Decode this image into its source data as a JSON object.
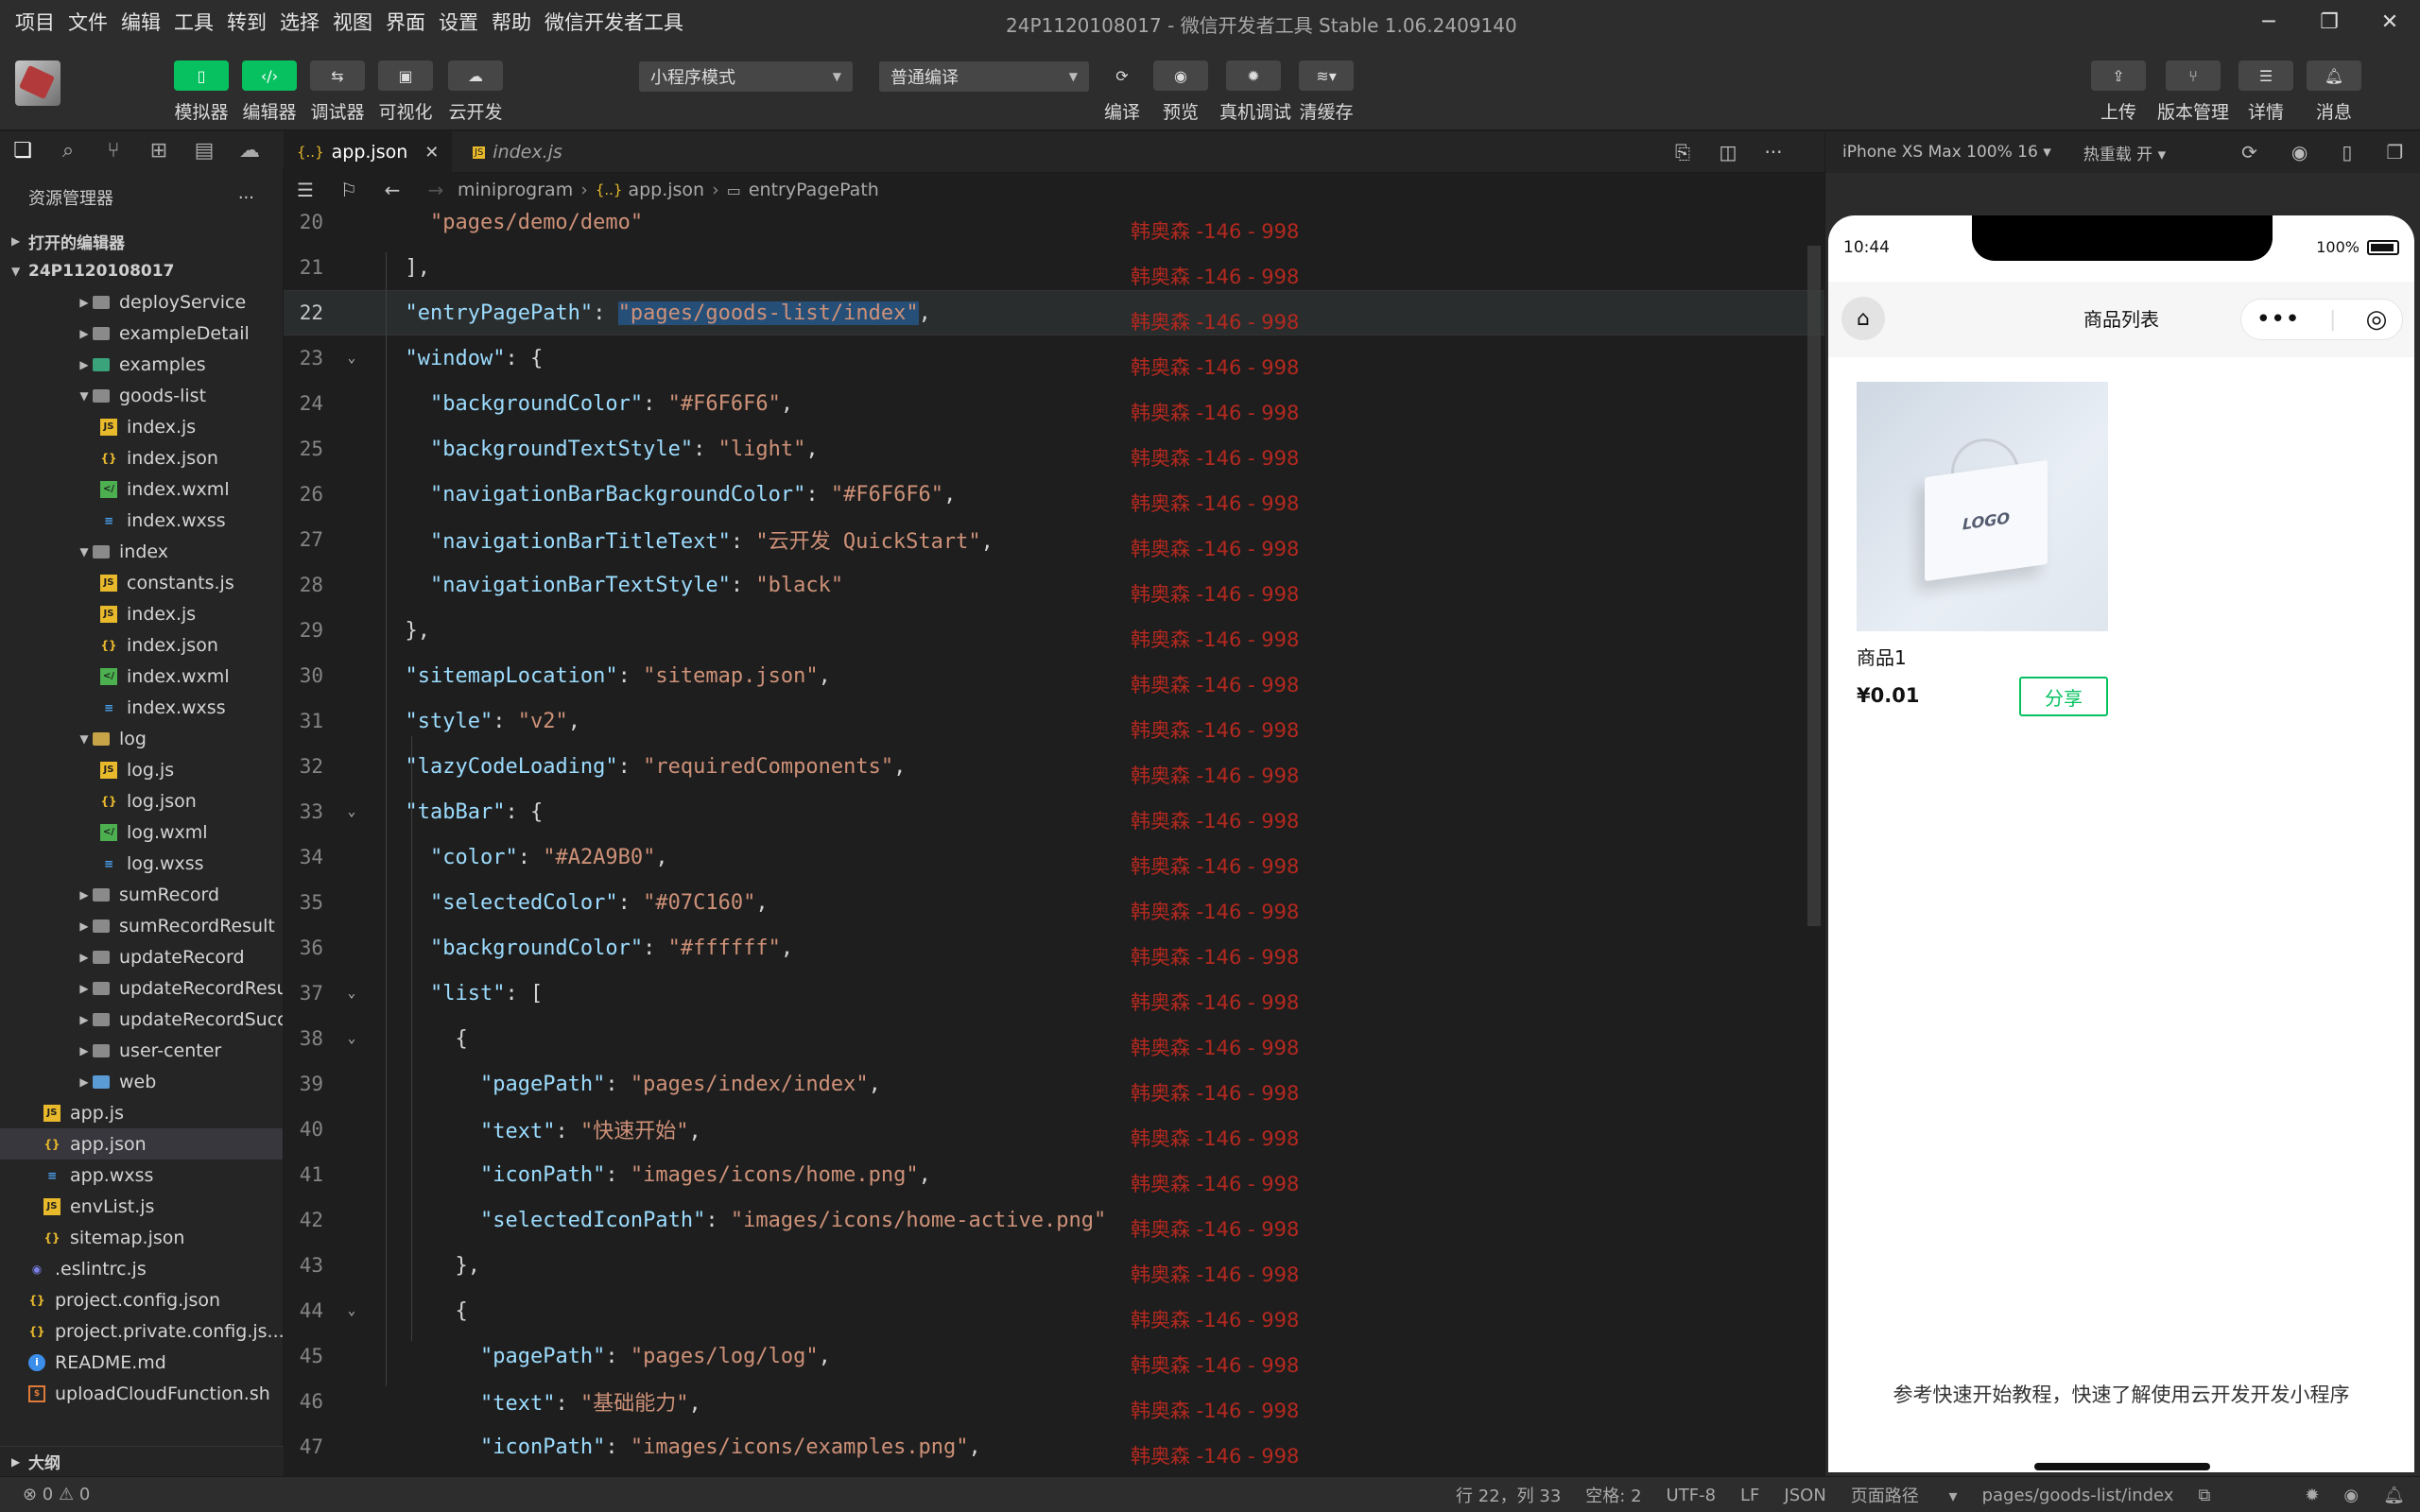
{
  "menu": [
    "项目",
    "文件",
    "编辑",
    "工具",
    "转到",
    "选择",
    "视图",
    "界面",
    "设置",
    "帮助",
    "微信开发者工具"
  ],
  "window_title": "24P1120108017 - 微信开发者工具 Stable 1.06.2409140",
  "toolbar": {
    "simulator": "模拟器",
    "editor": "编辑器",
    "debugger": "调试器",
    "visual": "可视化",
    "cloud": "云开发",
    "mode_select": "小程序模式",
    "compile_select": "普通编译",
    "compile": "编译",
    "preview": "预览",
    "real_debug": "真机调试",
    "clear_cache": "清缓存",
    "upload": "上传",
    "version": "版本管理",
    "details": "详情",
    "messages": "消息"
  },
  "explorer": {
    "title": "资源管理器",
    "open_editors": "打开的编辑器",
    "project": "24P1120108017",
    "outline": "大纲",
    "items": [
      {
        "label": "deployService",
        "type": "folder"
      },
      {
        "label": "exampleDetail",
        "type": "folder"
      },
      {
        "label": "examples",
        "type": "folder"
      },
      {
        "label": "goods-list",
        "type": "folder-open"
      },
      {
        "label": "index.js",
        "type": "js"
      },
      {
        "label": "index.json",
        "type": "json"
      },
      {
        "label": "index.wxml",
        "type": "wxml"
      },
      {
        "label": "index.wxss",
        "type": "wxss"
      },
      {
        "label": "index",
        "type": "folder-open"
      },
      {
        "label": "constants.js",
        "type": "js"
      },
      {
        "label": "index.js",
        "type": "js"
      },
      {
        "label": "index.json",
        "type": "json"
      },
      {
        "label": "index.wxml",
        "type": "wxml"
      },
      {
        "label": "index.wxss",
        "type": "wxss"
      },
      {
        "label": "log",
        "type": "folder-open"
      },
      {
        "label": "log.js",
        "type": "js"
      },
      {
        "label": "log.json",
        "type": "json"
      },
      {
        "label": "log.wxml",
        "type": "wxml"
      },
      {
        "label": "log.wxss",
        "type": "wxss"
      },
      {
        "label": "sumRecord",
        "type": "folder"
      },
      {
        "label": "sumRecordResult",
        "type": "folder"
      },
      {
        "label": "updateRecord",
        "type": "folder"
      },
      {
        "label": "updateRecordResult",
        "type": "folder"
      },
      {
        "label": "updateRecordSuccess",
        "type": "folder"
      },
      {
        "label": "user-center",
        "type": "folder"
      },
      {
        "label": "web",
        "type": "folder"
      },
      {
        "label": "app.js",
        "type": "js"
      },
      {
        "label": "app.json",
        "type": "json"
      },
      {
        "label": "app.wxss",
        "type": "wxss"
      },
      {
        "label": "envList.js",
        "type": "js"
      },
      {
        "label": "sitemap.json",
        "type": "json"
      },
      {
        "label": ".eslintrc.js",
        "type": "eslint"
      },
      {
        "label": "project.config.json",
        "type": "json"
      },
      {
        "label": "project.private.config.js...",
        "type": "json"
      },
      {
        "label": "README.md",
        "type": "info"
      },
      {
        "label": "uploadCloudFunction.sh",
        "type": "sh"
      }
    ]
  },
  "tabs": [
    {
      "label": "app.json",
      "active": true
    },
    {
      "label": "index.js",
      "active": false
    }
  ],
  "breadcrumb": [
    "miniprogram",
    "app.json",
    "entryPagePath"
  ],
  "code": {
    "watermark": "韩奥森 -146 - 998",
    "lines": [
      {
        "n": "20",
        "text": "    \"pages/demo/demo\""
      },
      {
        "n": "21",
        "text": "  ],"
      },
      {
        "n": "22",
        "text": "  \"entryPagePath\": \"pages/goods-list/index\","
      },
      {
        "n": "23",
        "text": "  \"window\": {"
      },
      {
        "n": "24",
        "text": "    \"backgroundColor\": \"#F6F6F6\","
      },
      {
        "n": "25",
        "text": "    \"backgroundTextStyle\": \"light\","
      },
      {
        "n": "26",
        "text": "    \"navigationBarBackgroundColor\": \"#F6F6F6\","
      },
      {
        "n": "27",
        "text": "    \"navigationBarTitleText\": \"云开发 QuickStart\","
      },
      {
        "n": "28",
        "text": "    \"navigationBarTextStyle\": \"black\""
      },
      {
        "n": "29",
        "text": "  },"
      },
      {
        "n": "30",
        "text": "  \"sitemapLocation\": \"sitemap.json\","
      },
      {
        "n": "31",
        "text": "  \"style\": \"v2\","
      },
      {
        "n": "32",
        "text": "  \"lazyCodeLoading\": \"requiredComponents\","
      },
      {
        "n": "33",
        "text": "  \"tabBar\": {"
      },
      {
        "n": "34",
        "text": "    \"color\": \"#A2A9B0\","
      },
      {
        "n": "35",
        "text": "    \"selectedColor\": \"#07C160\","
      },
      {
        "n": "36",
        "text": "    \"backgroundColor\": \"#ffffff\","
      },
      {
        "n": "37",
        "text": "    \"list\": ["
      },
      {
        "n": "38",
        "text": "      {"
      },
      {
        "n": "39",
        "text": "        \"pagePath\": \"pages/index/index\","
      },
      {
        "n": "40",
        "text": "        \"text\": \"快速开始\","
      },
      {
        "n": "41",
        "text": "        \"iconPath\": \"images/icons/home.png\","
      },
      {
        "n": "42",
        "text": "        \"selectedIconPath\": \"images/icons/home-active.png\""
      },
      {
        "n": "43",
        "text": "      },"
      },
      {
        "n": "44",
        "text": "      {"
      },
      {
        "n": "45",
        "text": "        \"pagePath\": \"pages/log/log\","
      },
      {
        "n": "46",
        "text": "        \"text\": \"基础能力\","
      },
      {
        "n": "47",
        "text": "        \"iconPath\": \"images/icons/examples.png\","
      }
    ]
  },
  "simulator": {
    "device": "iPhone XS Max 100% 16",
    "hot_reload": "热重载 开",
    "status_time": "10:44",
    "battery": "100%",
    "page_title": "商品列表",
    "product_name": "商品1",
    "product_price": "¥0.01",
    "share_label": "分享",
    "image_logo": "LOGO",
    "tip": "参考快速开始教程，快速了解使用云开发开发小程序"
  },
  "statusbar": {
    "problems": "⊗ 0 ⚠ 0",
    "position": "行 22，列 33",
    "indent": "空格: 2",
    "encoding": "UTF-8",
    "eol": "LF",
    "language": "JSON",
    "page_path_label": "页面路径",
    "page_path": "pages/goods-list/index"
  }
}
